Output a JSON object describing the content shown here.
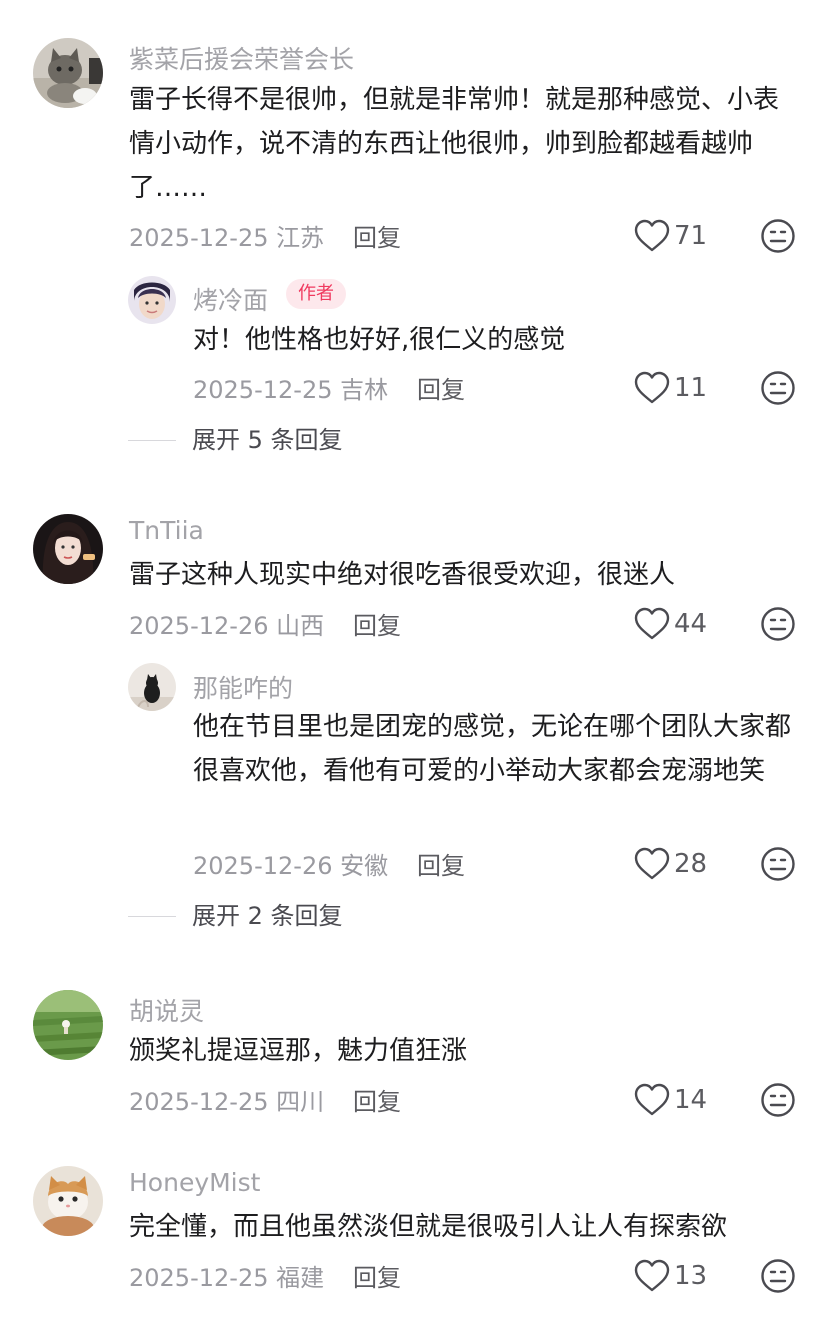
{
  "comments": [
    {
      "username": "紫菜后援会荣誉会长",
      "avatar": "gray-cat-avatar",
      "text": "雷子长得不是很帅，但就是非常帅！就是那种感觉、小表情小动作，说不清的东西让他很帅，帅到脸都越看越帅了……",
      "date": "2025-12-25 江苏",
      "reply_label": "回复",
      "likes": "71",
      "reply": {
        "username": "烤冷面",
        "badge": "作者",
        "avatar": "person-avatar",
        "text": "对！他性格也好好,很仁义的感觉",
        "date": "2025-12-25 吉林",
        "reply_label": "回复",
        "likes": "11"
      },
      "expand_label": "展开 5 条回复"
    },
    {
      "username": "TnTiia",
      "avatar": "woman-portrait-avatar",
      "text": "雷子这种人现实中绝对很吃香很受欢迎，很迷人",
      "date": "2025-12-26 山西",
      "reply_label": "回复",
      "likes": "44",
      "reply": {
        "username": "那能咋的",
        "avatar": "cat-silhouette-avatar",
        "text": "他在节目里也是团宠的感觉，无论在哪个团队大家都很喜欢他，看他有可爱的小举动大家都会宠溺地笑",
        "date": "2025-12-26 安徽",
        "reply_label": "回复",
        "likes": "28"
      },
      "expand_label": "展开 2 条回复"
    },
    {
      "username": "胡说灵",
      "avatar": "green-field-avatar",
      "text": "颁奖礼提逗逗那，魅力值狂涨",
      "date": "2025-12-25 四川",
      "reply_label": "回复",
      "likes": "14"
    },
    {
      "username": "HoneyMist",
      "avatar": "orange-cat-avatar",
      "text": "完全懂，而且他虽然淡但就是很吸引人让人有探索欲",
      "date": "2025-12-25 福建",
      "reply_label": "回复",
      "likes": "13"
    }
  ],
  "colors": {
    "username": "#a3a3a8",
    "text": "#1d1d1f",
    "meta": "#9a9aa0",
    "author_badge_text": "#f03a5f",
    "author_badge_bg": "#fde8ec"
  },
  "icons": {
    "like": "heart-outline-icon",
    "more": "meh-face-icon"
  }
}
